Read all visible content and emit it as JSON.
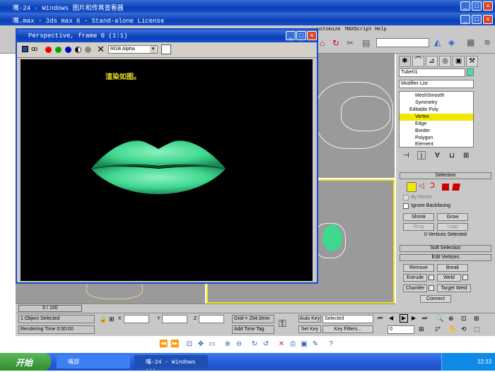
{
  "viewer_title": "嘴-24 - Windows 图片和传真查看器",
  "max_title": "嘴.max - 3ds max 6 - Stand-alone License",
  "menu": {
    "customize": "ustomize",
    "maxscript": "MAXScript",
    "help": "Help"
  },
  "render": {
    "title": "Perspective, frame 0 (1:1)",
    "channel": "RGB Alpha",
    "caption": "渲染如图。",
    "lips_color": "#3fd88f"
  },
  "panel": {
    "object_name": "Tube01",
    "modifier_list": "Modifier List",
    "stack": [
      "MeshSmooth",
      "Symmetry",
      "Editable Poly",
      "Vertex",
      "Edge",
      "Border",
      "Polygon",
      "Element"
    ],
    "selection": "Selection",
    "by_vertex": "By Vertex",
    "ignore_backfacing": "Ignore Backfacing",
    "shrink": "Shrink",
    "grow": "Grow",
    "ring": "Ring",
    "loop": "Loop",
    "vertices_selected": "0 Vertices Selected",
    "soft_selection": "Soft Selection",
    "edit_vertices": "Edit Vertices",
    "remove": "Remove",
    "break": "Break",
    "extrude": "Extrude",
    "weld": "Weld",
    "chamfer": "Chamfer",
    "target_weld": "Target Weld",
    "connect": "Connect"
  },
  "status": {
    "frame": "0 / 100",
    "selected": "1 Object Selected",
    "render_time": "Rendering Time  0:00:00",
    "x": "X",
    "y": "Y",
    "z": "Z",
    "grid": "Grid = 254.0mm",
    "add_time_tag": "Add Time Tag",
    "auto_key": "Auto Key",
    "set_key": "Set Key",
    "selected_dropdown": "Selected",
    "key_filters": "Key Filters...",
    "frame_num": "0"
  },
  "taskbar": {
    "start": "开始",
    "task1": "嘴部",
    "task2": "嘴-24 - Windows ...",
    "clock": "22:33"
  }
}
